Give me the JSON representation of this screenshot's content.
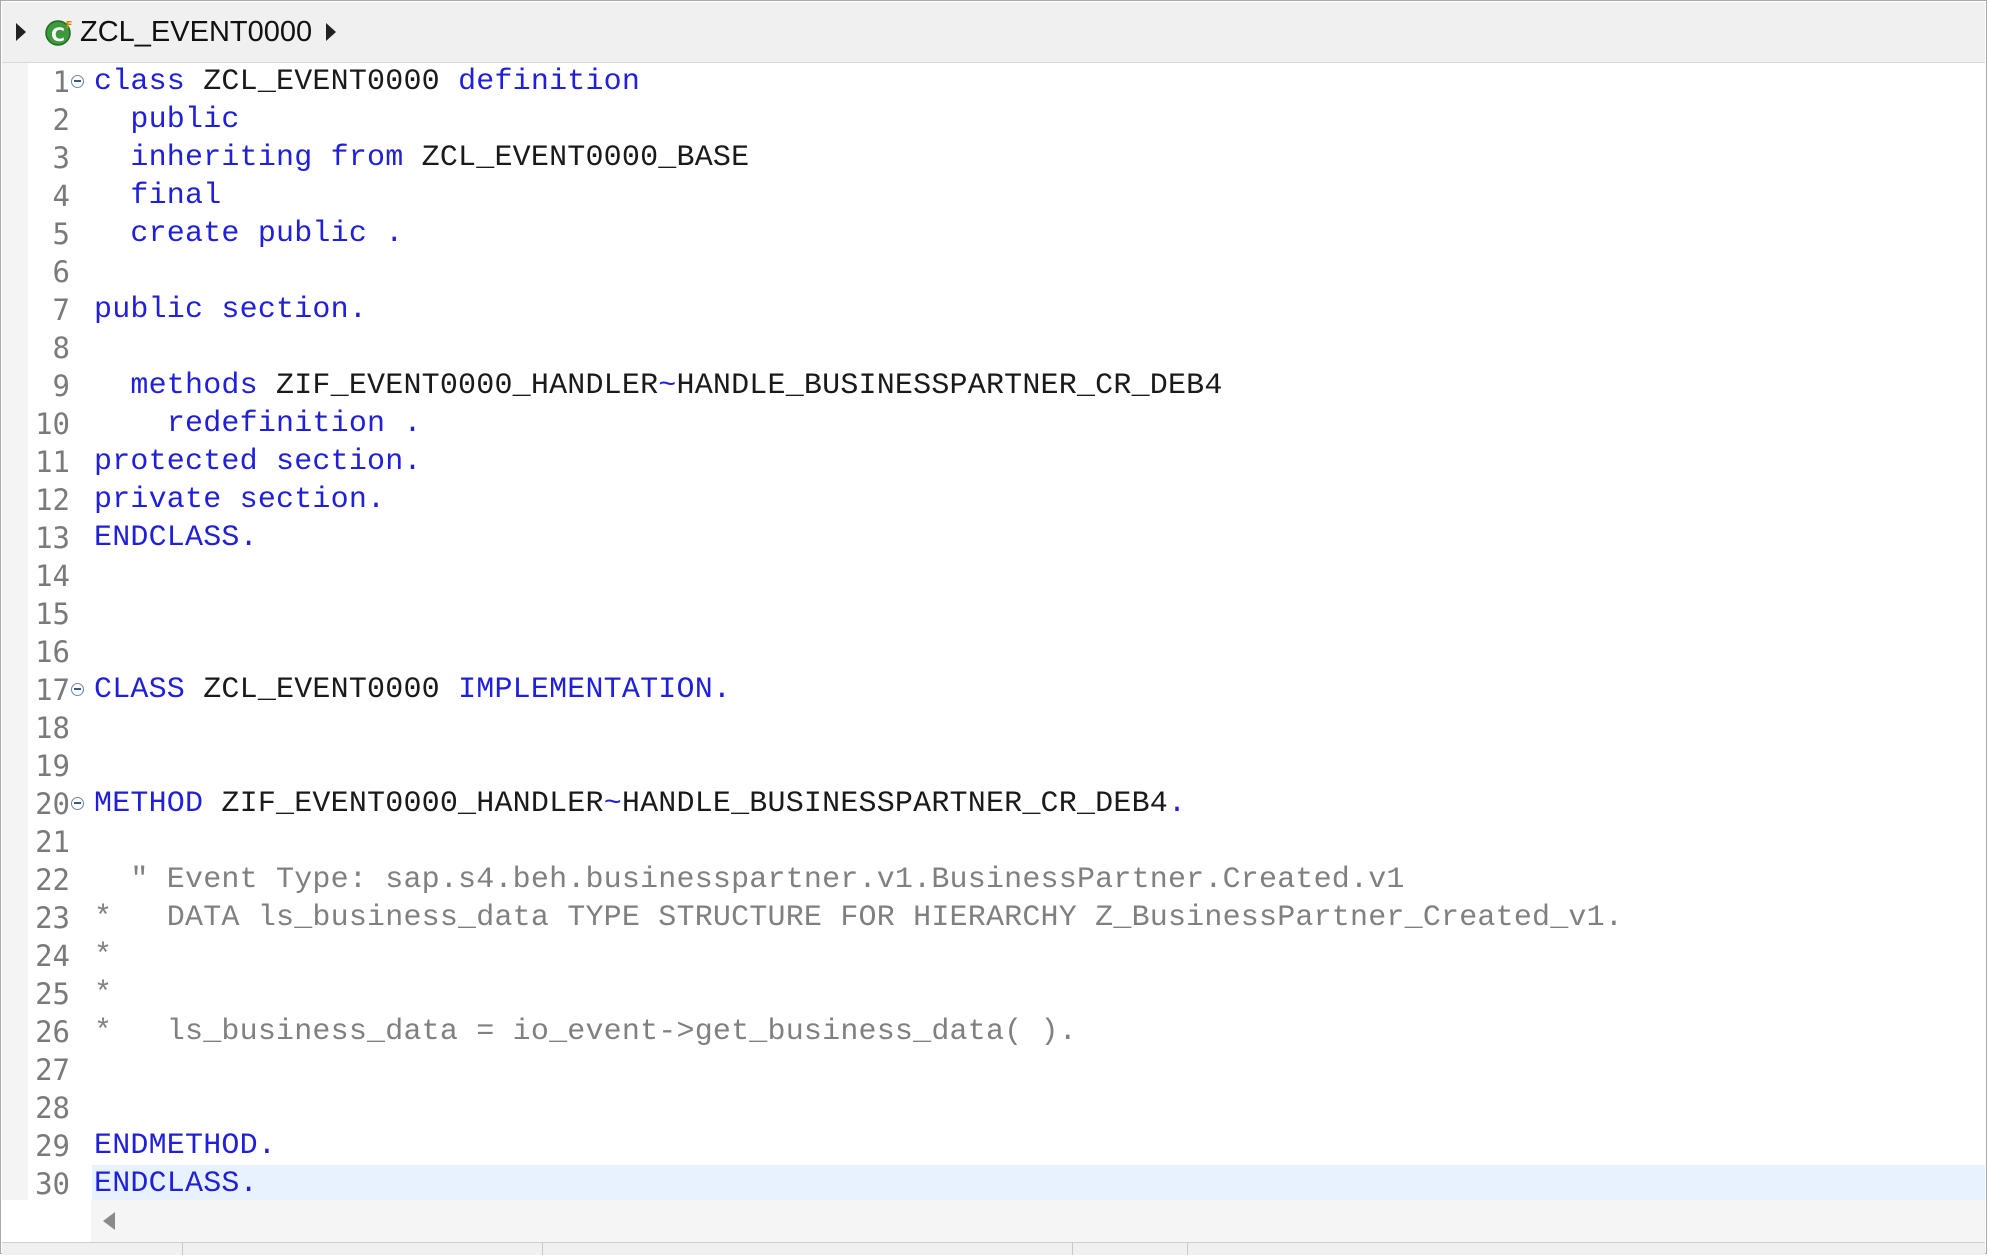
{
  "breadcrumb": {
    "class_name": "ZCL_EVENT0000",
    "class_icon": "abap-class-icon",
    "collapse_icon": "expand-arrow-icon",
    "next_icon": "chevron-right-icon"
  },
  "editor": {
    "current_line": 30,
    "lines": [
      {
        "n": "1",
        "fold": true,
        "tokens": [
          {
            "t": "class",
            "c": "kw"
          },
          {
            "t": " ZCL_EVENT0000 ",
            "c": "txt"
          },
          {
            "t": "definition",
            "c": "kw"
          }
        ]
      },
      {
        "n": "2",
        "tokens": [
          {
            "t": "  ",
            "c": "txt"
          },
          {
            "t": "public",
            "c": "kw"
          }
        ]
      },
      {
        "n": "3",
        "tokens": [
          {
            "t": "  ",
            "c": "txt"
          },
          {
            "t": "inheriting from",
            "c": "kw"
          },
          {
            "t": " ZCL_EVENT0000_BASE",
            "c": "txt"
          }
        ]
      },
      {
        "n": "4",
        "tokens": [
          {
            "t": "  ",
            "c": "txt"
          },
          {
            "t": "final",
            "c": "kw"
          }
        ]
      },
      {
        "n": "5",
        "tokens": [
          {
            "t": "  ",
            "c": "txt"
          },
          {
            "t": "create public .",
            "c": "kw"
          }
        ]
      },
      {
        "n": "6",
        "tokens": []
      },
      {
        "n": "7",
        "tokens": [
          {
            "t": "public section.",
            "c": "kw"
          }
        ]
      },
      {
        "n": "8",
        "tokens": []
      },
      {
        "n": "9",
        "tokens": [
          {
            "t": "  ",
            "c": "txt"
          },
          {
            "t": "methods",
            "c": "kw"
          },
          {
            "t": " ZIF_EVENT0000_HANDLER",
            "c": "txt"
          },
          {
            "t": "~",
            "c": "kw"
          },
          {
            "t": "HANDLE_BUSINESSPARTNER_CR_DEB4",
            "c": "txt"
          }
        ]
      },
      {
        "n": "10",
        "tokens": [
          {
            "t": "    ",
            "c": "txt"
          },
          {
            "t": "redefinition .",
            "c": "kw"
          }
        ]
      },
      {
        "n": "11",
        "tokens": [
          {
            "t": "protected section.",
            "c": "kw"
          }
        ]
      },
      {
        "n": "12",
        "tokens": [
          {
            "t": "private section.",
            "c": "kw"
          }
        ]
      },
      {
        "n": "13",
        "tokens": [
          {
            "t": "ENDCLASS.",
            "c": "kw"
          }
        ]
      },
      {
        "n": "14",
        "tokens": []
      },
      {
        "n": "15",
        "tokens": []
      },
      {
        "n": "16",
        "tokens": []
      },
      {
        "n": "17",
        "fold": true,
        "tokens": [
          {
            "t": "CLASS",
            "c": "kw"
          },
          {
            "t": " ZCL_EVENT0000 ",
            "c": "txt"
          },
          {
            "t": "IMPLEMENTATION.",
            "c": "kw"
          }
        ]
      },
      {
        "n": "18",
        "tokens": []
      },
      {
        "n": "19",
        "tokens": []
      },
      {
        "n": "20",
        "fold": true,
        "tokens": [
          {
            "t": "METHOD",
            "c": "kw"
          },
          {
            "t": " ZIF_EVENT0000_HANDLER",
            "c": "txt"
          },
          {
            "t": "~",
            "c": "kw"
          },
          {
            "t": "HANDLE_BUSINESSPARTNER_CR_DEB4",
            "c": "txt"
          },
          {
            "t": ".",
            "c": "kw"
          }
        ]
      },
      {
        "n": "21",
        "tokens": []
      },
      {
        "n": "22",
        "tokens": [
          {
            "t": "  \" Event Type: sap.s4.beh.businesspartner.v1.BusinessPartner.Created.v1",
            "c": "cm"
          }
        ]
      },
      {
        "n": "23",
        "tokens": [
          {
            "t": "*   DATA ls_business_data TYPE STRUCTURE FOR HIERARCHY Z_BusinessPartner_Created_v1.",
            "c": "cm"
          }
        ]
      },
      {
        "n": "24",
        "tokens": [
          {
            "t": "*",
            "c": "cm"
          }
        ]
      },
      {
        "n": "25",
        "tokens": [
          {
            "t": "*",
            "c": "cm"
          }
        ]
      },
      {
        "n": "26",
        "tokens": [
          {
            "t": "*   ls_business_data = io_event->get_business_data( ).",
            "c": "cm"
          }
        ]
      },
      {
        "n": "27",
        "tokens": []
      },
      {
        "n": "28",
        "tokens": []
      },
      {
        "n": "29",
        "tokens": [
          {
            "t": "ENDMETHOD.",
            "c": "kw"
          }
        ]
      },
      {
        "n": "30",
        "tokens": [
          {
            "t": "ENDCLASS.",
            "c": "kw"
          }
        ]
      }
    ]
  },
  "scrollbar": {
    "left_icon": "scroll-left-arrow-icon"
  }
}
